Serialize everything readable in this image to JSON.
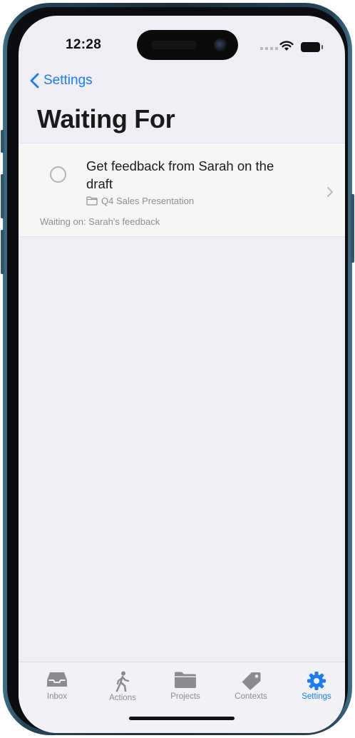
{
  "status_bar": {
    "time": "12:28"
  },
  "nav": {
    "back_label": "Settings"
  },
  "page": {
    "title": "Waiting For"
  },
  "tasks": [
    {
      "title": "Get feedback from Sarah on the draft",
      "project": "Q4 Sales Presentation",
      "waiting_on": "Waiting on: Sarah's feedback"
    }
  ],
  "tabbar": {
    "items": [
      {
        "label": "Inbox",
        "icon": "inbox-tray-icon",
        "active": false
      },
      {
        "label": "Actions",
        "icon": "walking-person-icon",
        "active": false
      },
      {
        "label": "Projects",
        "icon": "folder-icon",
        "active": false
      },
      {
        "label": "Contexts",
        "icon": "tag-icon",
        "active": false
      },
      {
        "label": "Settings",
        "icon": "gear-icon",
        "active": true
      }
    ]
  },
  "colors": {
    "accent": "#1b7cf3",
    "background": "#efeef4",
    "tab_inactive": "#8b8b90"
  }
}
